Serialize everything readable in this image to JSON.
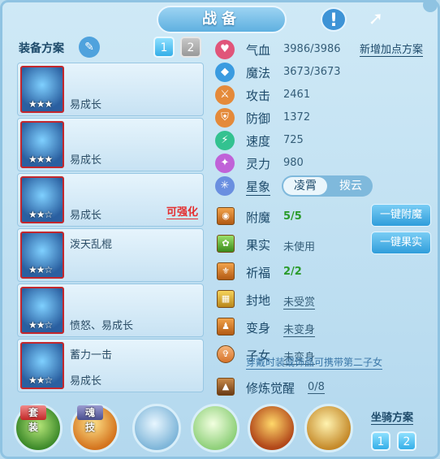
{
  "header": {
    "title": "战备",
    "info_icon": "info-icon",
    "share_icon": "share-icon"
  },
  "plan": {
    "label": "装备方案",
    "edit_icon": "pencil-icon",
    "tabs": [
      "1",
      "2"
    ],
    "active": "1"
  },
  "equipment": [
    {
      "line1": "",
      "line2": "易成长",
      "stars": "★★★",
      "enhance": ""
    },
    {
      "line1": "",
      "line2": "易成长",
      "stars": "★★★",
      "enhance": ""
    },
    {
      "line1": "",
      "line2": "易成长",
      "stars": "★★☆",
      "enhance": "可强化"
    },
    {
      "line1": "泼天乱棍",
      "line2": "",
      "stars": "★★☆",
      "enhance": ""
    },
    {
      "line1": "",
      "line2": "愤怒、易成长",
      "stars": "★★☆",
      "enhance": ""
    },
    {
      "line1": "蓄力一击",
      "line2": "易成长",
      "stars": "★★☆",
      "enhance": ""
    }
  ],
  "stats": [
    {
      "label": "气血",
      "value": "3986/3986",
      "icon": "heart-icon",
      "color": "#e0557a"
    },
    {
      "label": "魔法",
      "value": "3673/3673",
      "icon": "diamond-icon",
      "color": "#3a9be0"
    },
    {
      "label": "攻击",
      "value": "2461",
      "icon": "attack-icon",
      "color": "#e48a3a"
    },
    {
      "label": "防御",
      "value": "1372",
      "icon": "shield-icon",
      "color": "#e48a3a"
    },
    {
      "label": "速度",
      "value": "725",
      "icon": "lightning-icon",
      "color": "#33c290"
    },
    {
      "label": "灵力",
      "value": "980",
      "icon": "spirit-icon",
      "color": "#c062d8"
    }
  ],
  "add_plan": "新增加点方案",
  "xingxiang": {
    "label": "星象",
    "options": [
      "凌霄",
      "拨云"
    ],
    "active": "凌霄"
  },
  "attachments": [
    {
      "label": "附魔",
      "value": "5/5",
      "style": "green",
      "button": "一键附魔"
    },
    {
      "label": "果实",
      "value": "未使用",
      "style": "plain",
      "button": "一键果实"
    },
    {
      "label": "祈福",
      "value": "2/2",
      "style": "green",
      "button": ""
    },
    {
      "label": "封地",
      "value": "未受赏",
      "style": "under",
      "button": ""
    },
    {
      "label": "变身",
      "value": "未变身",
      "style": "under",
      "button": ""
    },
    {
      "label": "子女",
      "value": "未变身",
      "style": "under",
      "button": ""
    }
  ],
  "note": "穿戴时装或饰品可携带第二子女",
  "xiulian": {
    "label": "修炼觉醒",
    "value": "0/8"
  },
  "bottom": {
    "suit_tag": "套装",
    "soul_tag": "魂技",
    "mount_label": "坐骑方案",
    "mount_tabs": [
      "1",
      "2"
    ]
  }
}
